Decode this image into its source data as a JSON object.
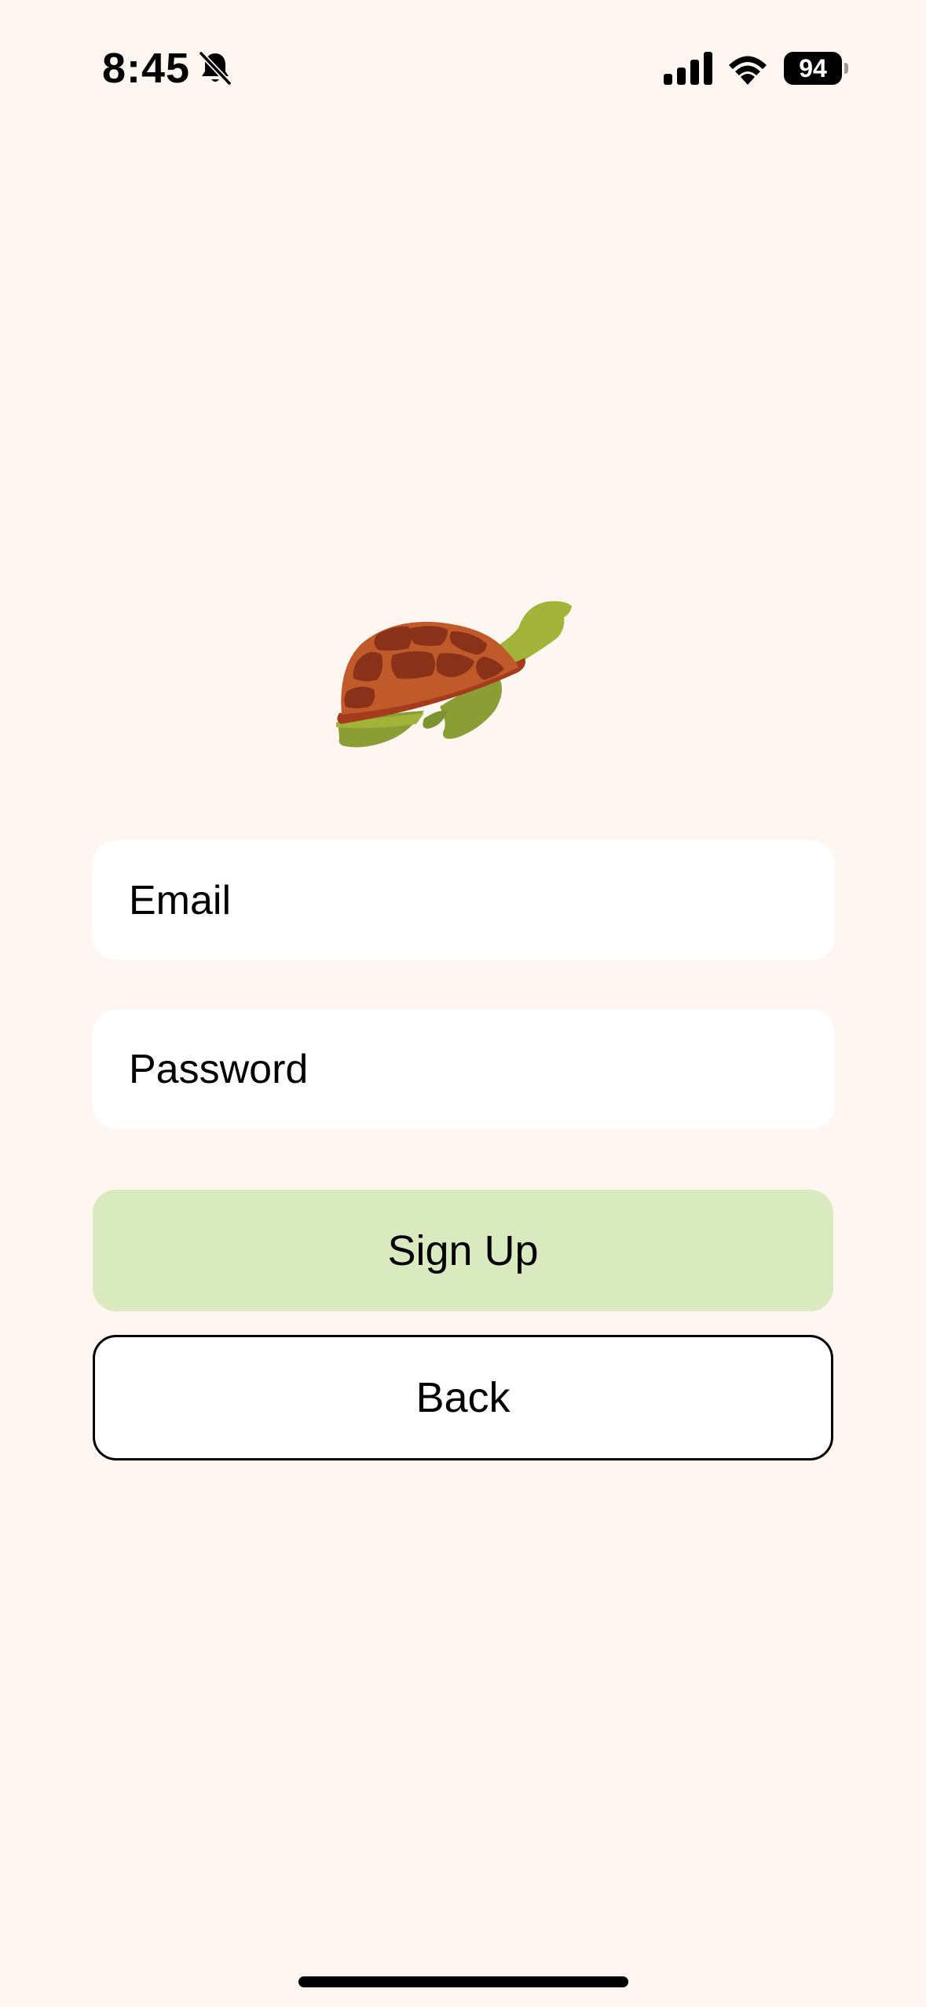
{
  "status_bar": {
    "time": "8:45",
    "battery_level": "94",
    "icons": [
      "bell-slash-icon",
      "cellular-signal-icon",
      "wifi-icon",
      "battery-icon"
    ]
  },
  "logo": {
    "icon": "turtle-icon"
  },
  "form": {
    "email_placeholder": "Email",
    "password_placeholder": "Password",
    "signup_label": "Sign Up",
    "back_label": "Back"
  },
  "colors": {
    "background": "#fff5f1",
    "field_background": "#ffffff",
    "signup_button": "#d8eabe",
    "back_button_border": "#000000"
  }
}
